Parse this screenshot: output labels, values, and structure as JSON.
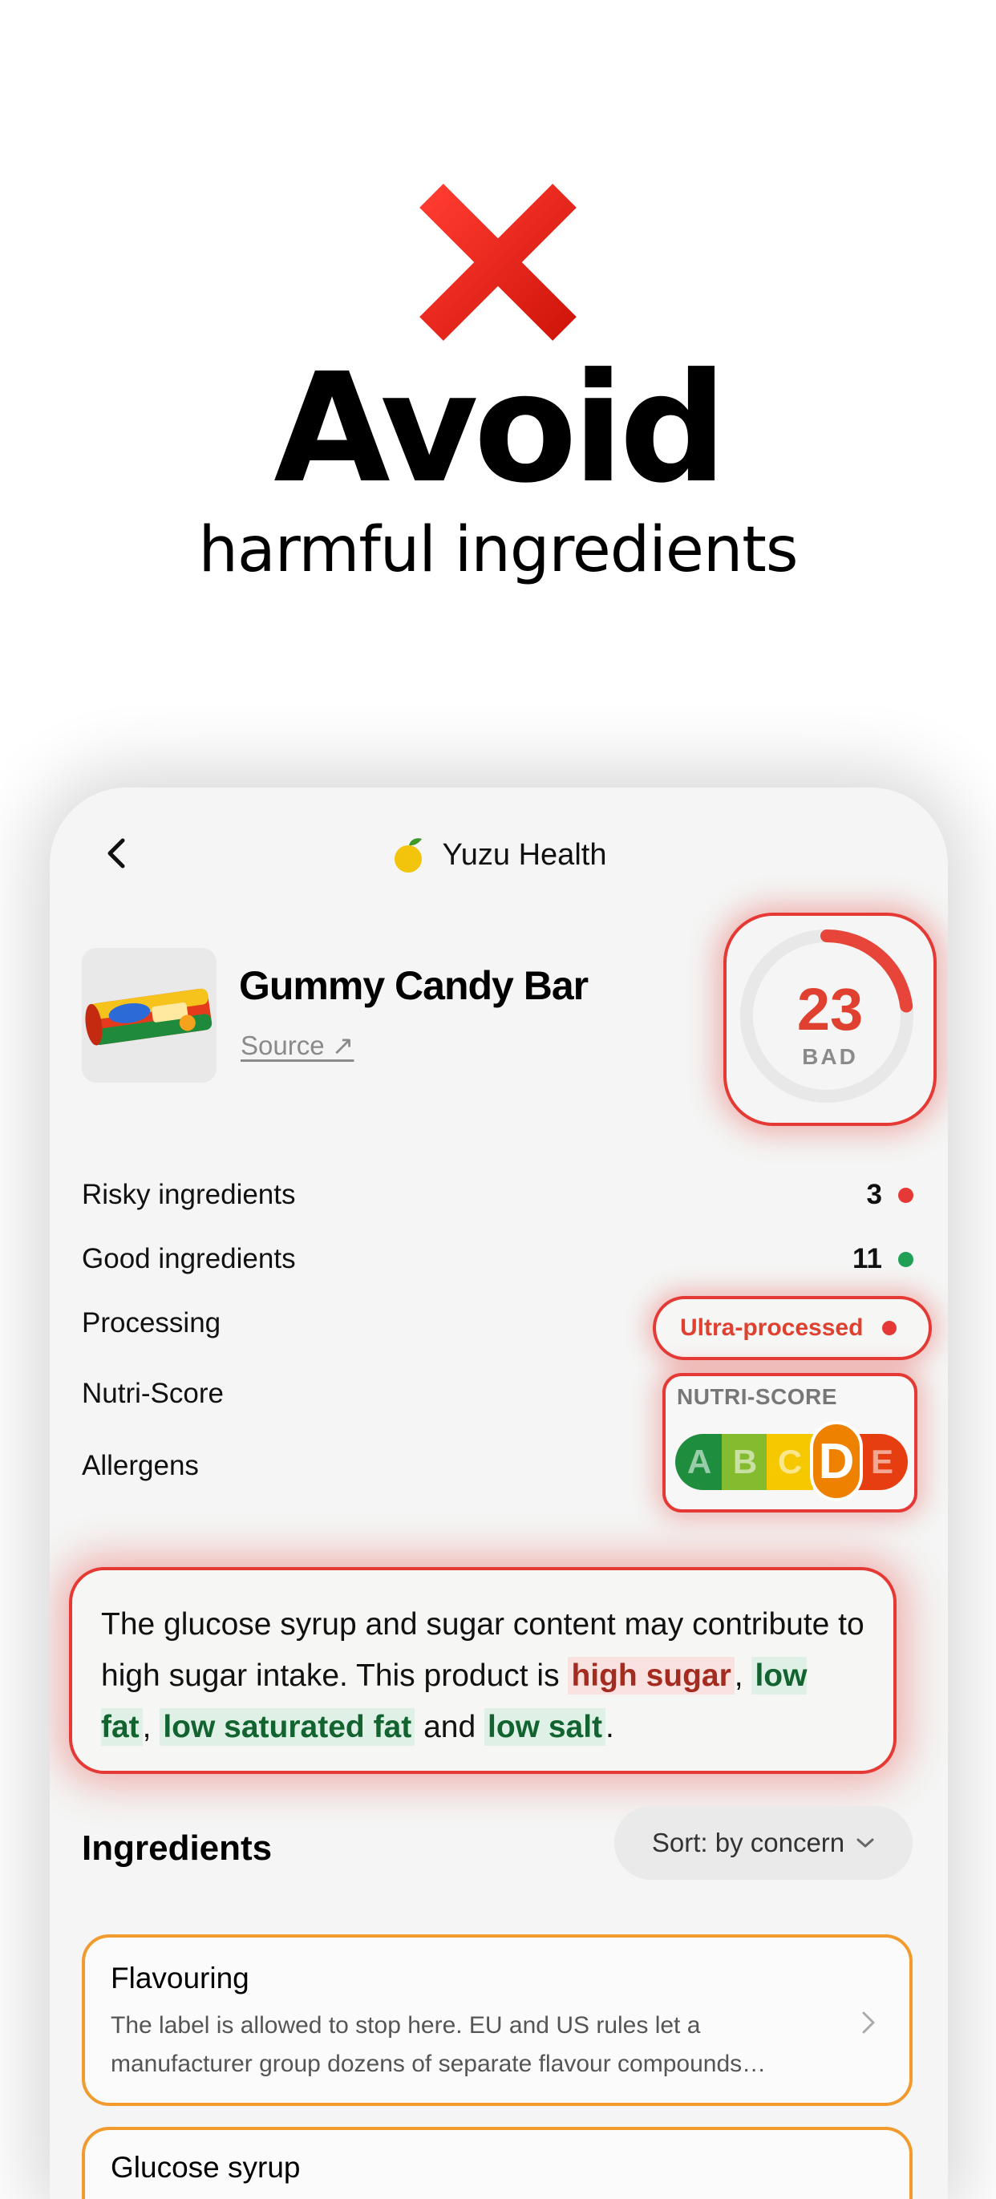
{
  "hero": {
    "icon": "cross-mark-icon",
    "title": "Avoid",
    "subtitle": "harmful ingredients"
  },
  "app": {
    "name": "Yuzu Health",
    "logo_icon": "yuzu-fruit-icon",
    "back_icon": "chevron-left-icon"
  },
  "product": {
    "name": "Gummy Candy Bar",
    "source_label": "Source ↗",
    "score": "23",
    "score_label": "BAD",
    "score_fraction": 0.23
  },
  "metrics": {
    "risky_label": "Risky ingredients",
    "risky_value": "3",
    "good_label": "Good ingredients",
    "good_value": "11",
    "processing_label": "Processing",
    "processing_value": "Ultra-processed",
    "nutri_label": "Nutri-Score",
    "allergens_label": "Allergens"
  },
  "nutri_score": {
    "title": "NUTRI-SCORE",
    "grades": [
      "A",
      "B",
      "C",
      "D",
      "E"
    ],
    "active": "D"
  },
  "summary": {
    "text_1": "The glucose syrup and sugar content may contribute to high sugar intake. This product is ",
    "high_sugar": "high sugar",
    "sep_1": ", ",
    "low_fat": "low fat",
    "sep_2": ", ",
    "low_saturated_fat": "low saturated fat",
    "and": " and ",
    "low_salt": "low salt",
    "end": "."
  },
  "ingredients": {
    "title": "Ingredients",
    "sort_label": "Sort: by concern",
    "items": [
      {
        "name": "Flavouring",
        "description": "The label is allowed to stop here. EU and US rules let a manufacturer group dozens of separate flavour compounds…"
      },
      {
        "name": "Glucose syrup"
      }
    ]
  },
  "colors": {
    "danger": "#e53935",
    "good": "#1fa055",
    "warning": "#f19a2e"
  }
}
